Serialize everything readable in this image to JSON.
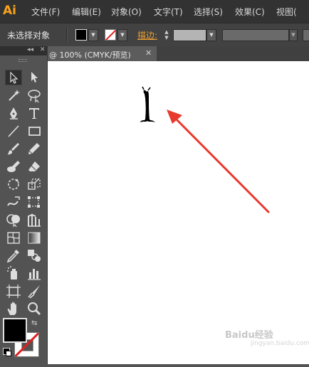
{
  "app": {
    "logo": "Ai",
    "accent": "#f7a21b"
  },
  "menu": {
    "items": [
      "文件(F)",
      "编辑(E)",
      "对象(O)",
      "文字(T)",
      "选择(S)",
      "效果(C)",
      "视图("
    ]
  },
  "control": {
    "selection_label": "未选择对象",
    "stroke_label": "描边:",
    "dropdown_glyph": "▼",
    "spin_up": "▲",
    "spin_down": "▼"
  },
  "document": {
    "tab_label": "@ 100% (CMYK/预览)",
    "close_glyph": "✕"
  },
  "tools_panel": {
    "collapse_glyph": "◂◂",
    "close_glyph": "✕",
    "tools": [
      "selection-tool",
      "direct-selection-tool",
      "magic-wand-tool",
      "lasso-tool",
      "pen-tool",
      "type-tool",
      "line-segment-tool",
      "rectangle-tool",
      "paintbrush-tool",
      "pencil-tool",
      "blob-brush-tool",
      "eraser-tool",
      "rotate-tool",
      "scale-tool",
      "warp-tool",
      "free-transform-tool",
      "shape-builder-tool",
      "perspective-grid-tool",
      "mesh-tool",
      "gradient-tool",
      "eyedropper-tool",
      "blend-tool",
      "symbol-sprayer-tool",
      "column-graph-tool",
      "artboard-tool",
      "slice-tool",
      "hand-tool",
      "zoom-tool"
    ],
    "swap_glyph": "⇆"
  },
  "colors": {
    "fill": "#000000",
    "stroke": "none",
    "annotation_arrow": "#e8392d"
  },
  "watermark": {
    "text": "Baidu经验",
    "subtext": "jingyan.baidu.com"
  }
}
